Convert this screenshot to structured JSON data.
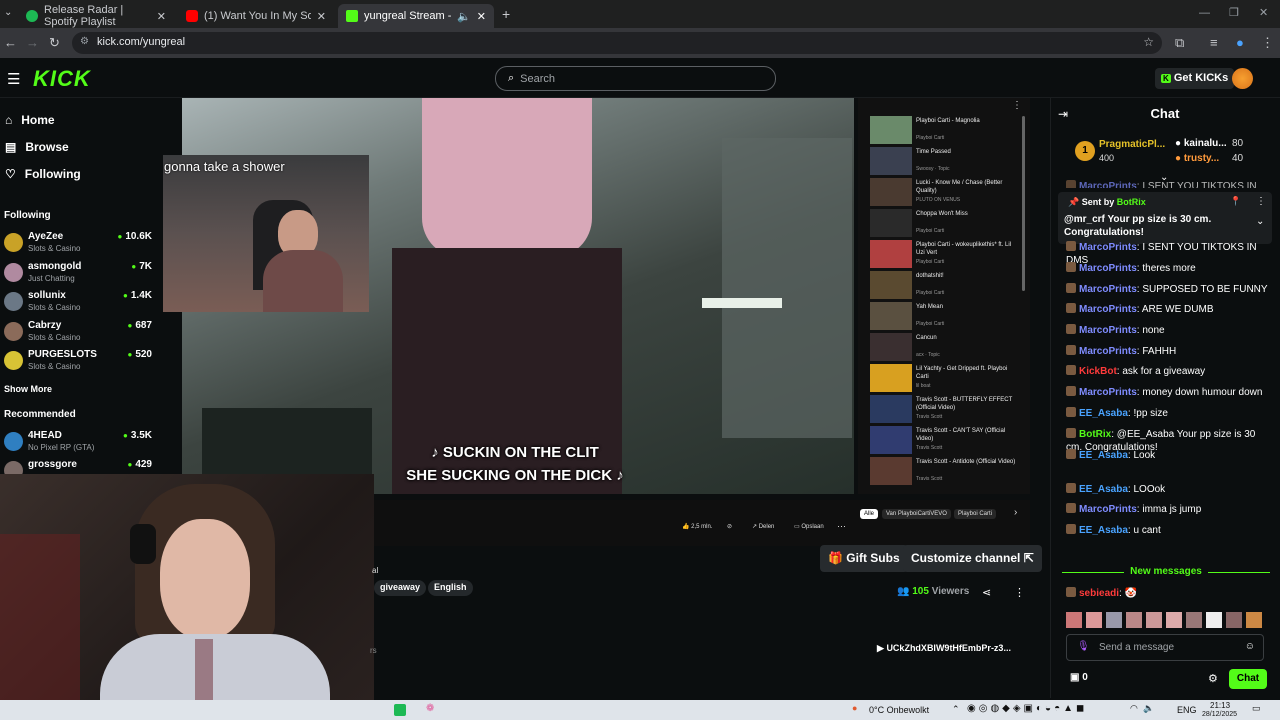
{
  "browser": {
    "tabs": [
      {
        "label": "Release Radar | Spotify Playlist",
        "color": "#1db954"
      },
      {
        "label": "(1) Want You In My Soul (feat. S",
        "color": "#ff0000"
      },
      {
        "label": "yungreal Stream - Watch Li",
        "color": "#53fc18"
      }
    ],
    "url": "kick.com/yungreal"
  },
  "kick": {
    "logo": "KICK",
    "search_placeholder": "Search",
    "get_kicks": "Get KICKs"
  },
  "sidebar": {
    "nav": [
      {
        "label": "Home",
        "icon": "home-icon"
      },
      {
        "label": "Browse",
        "icon": "browse-icon"
      },
      {
        "label": "Following",
        "icon": "heart-icon"
      }
    ],
    "following_title": "Following",
    "following": [
      {
        "name": "AyeZee",
        "category": "Slots & Casino",
        "viewers": "10.6K",
        "color": "#c9a227"
      },
      {
        "name": "asmongold",
        "category": "Just Chatting",
        "viewers": "7K",
        "color": "#b08aa0"
      },
      {
        "name": "sollunix",
        "category": "Slots & Casino",
        "viewers": "1.4K",
        "color": "#6b7886"
      },
      {
        "name": "Cabrzy",
        "category": "Slots & Casino",
        "viewers": "687",
        "color": "#8b6b5a"
      },
      {
        "name": "PURGESLOTS",
        "category": "Slots & Casino",
        "viewers": "520",
        "color": "#d8c335"
      }
    ],
    "show_more": "Show More",
    "recommended_title": "Recommended",
    "recommended": [
      {
        "name": "4HEAD",
        "category": "No Pixel RP (GTA)",
        "viewers": "3.5K",
        "color": "#2f7fc1"
      },
      {
        "name": "grossgore",
        "category": "",
        "viewers": "429",
        "color": "#7a6a66"
      }
    ]
  },
  "video": {
    "subtitle_line1": "♪ SUCKIN ON THE CLIT",
    "subtitle_line2": "SHE SUCKING ON THE DICK ♪",
    "cam_caption": "gonna take a shower",
    "playlist": [
      {
        "title": "Playboi Carti - Magnolia",
        "artist": "Playboi Carti"
      },
      {
        "title": "Time Passed",
        "artist": "Swoosy · Topic"
      },
      {
        "title": "Lucki - Know Me / Chase (Better Quality)",
        "artist": "PLUTO ON VENUS"
      },
      {
        "title": "Choppa Won't Miss",
        "artist": "Playboi Carti"
      },
      {
        "title": "Playboi Carti - wokeuplikethis* ft. Lil Uzi Vert",
        "artist": "Playboi Carti"
      },
      {
        "title": "dothatshit!",
        "artist": "Playboi Carti"
      },
      {
        "title": "Yah Mean",
        "artist": "Playboi Carti"
      },
      {
        "title": "Cancun",
        "artist": "acx · Topic"
      },
      {
        "title": "Lil Yachty - Get Dripped ft. Playboi Carti",
        "artist": "lil boat"
      },
      {
        "title": "Travis Scott - BUTTERFLY EFFECT (Official Video)",
        "artist": "Travis Scott"
      },
      {
        "title": "Travis Scott - CAN'T SAY (Official Video)",
        "artist": "Travis Scott"
      },
      {
        "title": "Travis Scott - Antidote (Official Video)",
        "artist": "Travis Scott"
      }
    ],
    "yt_likes": "2,5 mln.",
    "yt_share": "Delen",
    "yt_save": "Opslaan",
    "yt_chips": [
      "Alle",
      "Van PlayboiCartiVEVO",
      "Playboi Carti"
    ]
  },
  "stream": {
    "gift_subs": "Gift Subs",
    "customize": "Customize channel",
    "tags": [
      "giveaway",
      "English"
    ],
    "viewers_count": "105",
    "viewers_label": "Viewers",
    "link_text": "UCkZhdXBlW9tHfEmbPr-z3...",
    "partial_text": "al",
    "partial_text2": "rs"
  },
  "chat": {
    "title": "Chat",
    "leaders": [
      {
        "rank": "1",
        "name": "PragmaticPl...",
        "amount": "400"
      },
      {
        "name": "kainalu...",
        "amount": "80"
      },
      {
        "name": "trusty...",
        "amount": "40"
      }
    ],
    "pinned_sent_by": "Sent by",
    "pinned_user": "BotRix",
    "pinned_text": "@mr_crf Your pp size is 30 cm. Congratulations!",
    "messages": [
      {
        "user": "MarcoPrints",
        "text": "I SENT YOU TIKTOKS IN DMS",
        "color": "#7f8cff"
      },
      {
        "user": "MarcoPrints",
        "text": "I SENT YOU TIKTOKS IN DMS",
        "color": "#7f8cff"
      },
      {
        "user": "MarcoPrints",
        "text": "theres more",
        "color": "#7f8cff"
      },
      {
        "user": "MarcoPrints",
        "text": "SUPPOSED TO BE FUNNY",
        "color": "#7f8cff"
      },
      {
        "user": "MarcoPrints",
        "text": "ARE WE DUMB",
        "color": "#7f8cff"
      },
      {
        "user": "MarcoPrints",
        "text": "none",
        "color": "#7f8cff"
      },
      {
        "user": "MarcoPrints",
        "text": "FAHHH",
        "color": "#7f8cff"
      },
      {
        "user": "KickBot",
        "text": "ask for a giveaway",
        "color": "#ff3b3b"
      },
      {
        "user": "MarcoPrints",
        "text": "money down humour down",
        "color": "#7f8cff"
      },
      {
        "user": "EE_Asaba",
        "text": "!pp size",
        "color": "#4aa3ff"
      },
      {
        "user": "BotRix",
        "text": "@EE_Asaba Your pp size is 30 cm. Congratulations!",
        "color": "#53fc18"
      },
      {
        "user": "EE_Asaba",
        "text": "Look",
        "color": "#4aa3ff"
      },
      {
        "user": "EE_Asaba",
        "text": "LOOok",
        "color": "#4aa3ff"
      },
      {
        "user": "MarcoPrints",
        "text": "imma js jump",
        "color": "#7f8cff"
      },
      {
        "user": "EE_Asaba",
        "text": "u cant",
        "color": "#4aa3ff"
      }
    ],
    "new_messages": "New messages",
    "last_user": "sebieadi",
    "input_placeholder": "Send a message",
    "points": "0",
    "send_label": "Chat"
  },
  "taskbar": {
    "weather": "0°C  Onbewolkt",
    "lang": "ENG",
    "time": "21:13",
    "date": "28/12/2025"
  }
}
